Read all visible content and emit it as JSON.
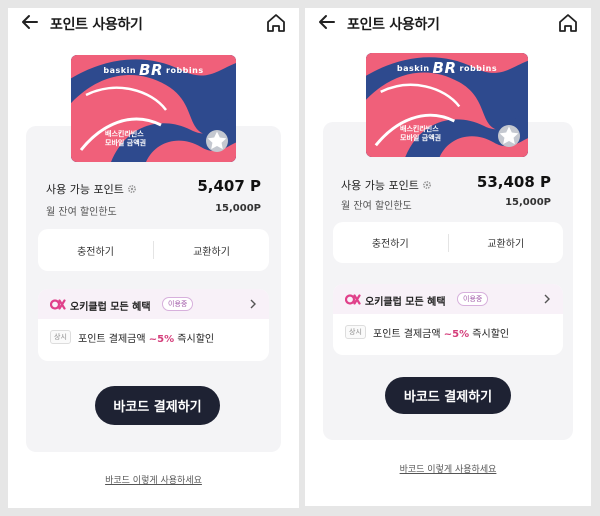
{
  "screens": [
    {
      "title": "포인트 사용하기",
      "card": {
        "brand_left": "baskin",
        "brand_mark": "BR",
        "brand_right": "robbins",
        "caption_line1": "배스킨라빈스",
        "caption_line2": "모바일 금액권"
      },
      "points": {
        "label": "사용 가능 포인트",
        "value": "5,407 P"
      },
      "limit": {
        "label": "월 잔여 할인한도",
        "value": "15,000P"
      },
      "actions": {
        "charge": "충전하기",
        "exchange": "교환하기"
      },
      "benefit": {
        "title": "오키클럽 모든 혜택",
        "badge": "이용중",
        "tag": "상시",
        "text_prefix": "포인트 결제금액 ",
        "text_pct": "~5%",
        "text_suffix": " 즉시할인"
      },
      "barcode_button": "바코드 결제하기",
      "howto_link": "바코드 이렇게 사용하세요"
    },
    {
      "title": "포인트 사용하기",
      "card": {
        "brand_left": "baskin",
        "brand_mark": "BR",
        "brand_right": "robbins",
        "caption_line1": "배스킨라빈스",
        "caption_line2": "모바일 금액권"
      },
      "points": {
        "label": "사용 가능 포인트",
        "value": "53,408 P"
      },
      "limit": {
        "label": "월 잔여 할인한도",
        "value": "15,000P"
      },
      "actions": {
        "charge": "충전하기",
        "exchange": "교환하기"
      },
      "benefit": {
        "title": "오키클럽 모든 혜택",
        "badge": "이용중",
        "tag": "상시",
        "text_prefix": "포인트 결제금액 ",
        "text_pct": "~5%",
        "text_suffix": " 즉시할인"
      },
      "barcode_button": "바코드 결제하기",
      "howto_link": "바코드 이렇게 사용하세요"
    }
  ],
  "colors": {
    "accent_pink": "#d43d7a",
    "card_navy": "#2e4a8e",
    "card_coral": "#f0607a",
    "button_dark": "#1e2233"
  },
  "icons": [
    "back-arrow-icon",
    "home-icon",
    "gear-icon",
    "star-icon",
    "okclub-logo-icon",
    "chevron-right-icon"
  ]
}
